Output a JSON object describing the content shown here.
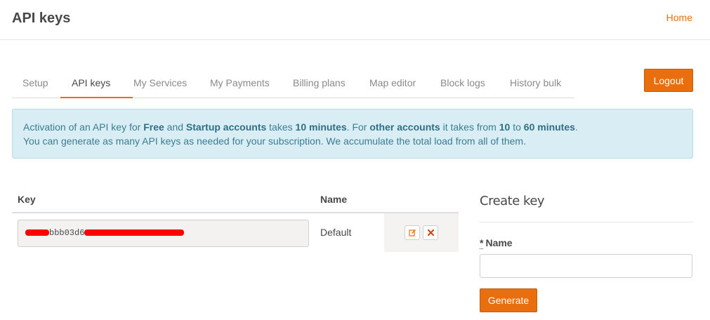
{
  "header": {
    "title": "API keys",
    "home_label": "Home"
  },
  "tabs": [
    {
      "label": "Setup",
      "active": false
    },
    {
      "label": "API keys",
      "active": true
    },
    {
      "label": "My Services",
      "active": false
    },
    {
      "label": "My Payments",
      "active": false
    },
    {
      "label": "Billing plans",
      "active": false
    },
    {
      "label": "Map editor",
      "active": false
    },
    {
      "label": "Block logs",
      "active": false
    },
    {
      "label": "History bulk",
      "active": false
    }
  ],
  "logout_label": "Logout",
  "info": {
    "line1": {
      "p1": "Activation of an API key for ",
      "b1": "Free",
      "p2": " and ",
      "b2": "Startup accounts",
      "p3": " takes ",
      "b3": "10 minutes",
      "p4": ". For ",
      "b4": "other accounts",
      "p5": " it takes from ",
      "b5": "10",
      "p6": " to ",
      "b6": "60 minutes",
      "p7": "."
    },
    "line2": "You can generate as many API keys as needed for your subscription. We accumulate the total load from all of them."
  },
  "table": {
    "headers": {
      "key": "Key",
      "name": "Name"
    },
    "rows": [
      {
        "key_visible": "bbb03d6",
        "name": "Default"
      }
    ]
  },
  "create": {
    "title": "Create key",
    "required_mark": "*",
    "name_label": "Name",
    "name_value": "",
    "generate_label": "Generate"
  },
  "colors": {
    "accent": "#e96e0e",
    "info_bg": "#d9eef4",
    "info_text": "#3a7d93",
    "redaction": "#ff0000"
  },
  "icons": {
    "edit": "edit-icon",
    "delete": "close-icon"
  }
}
